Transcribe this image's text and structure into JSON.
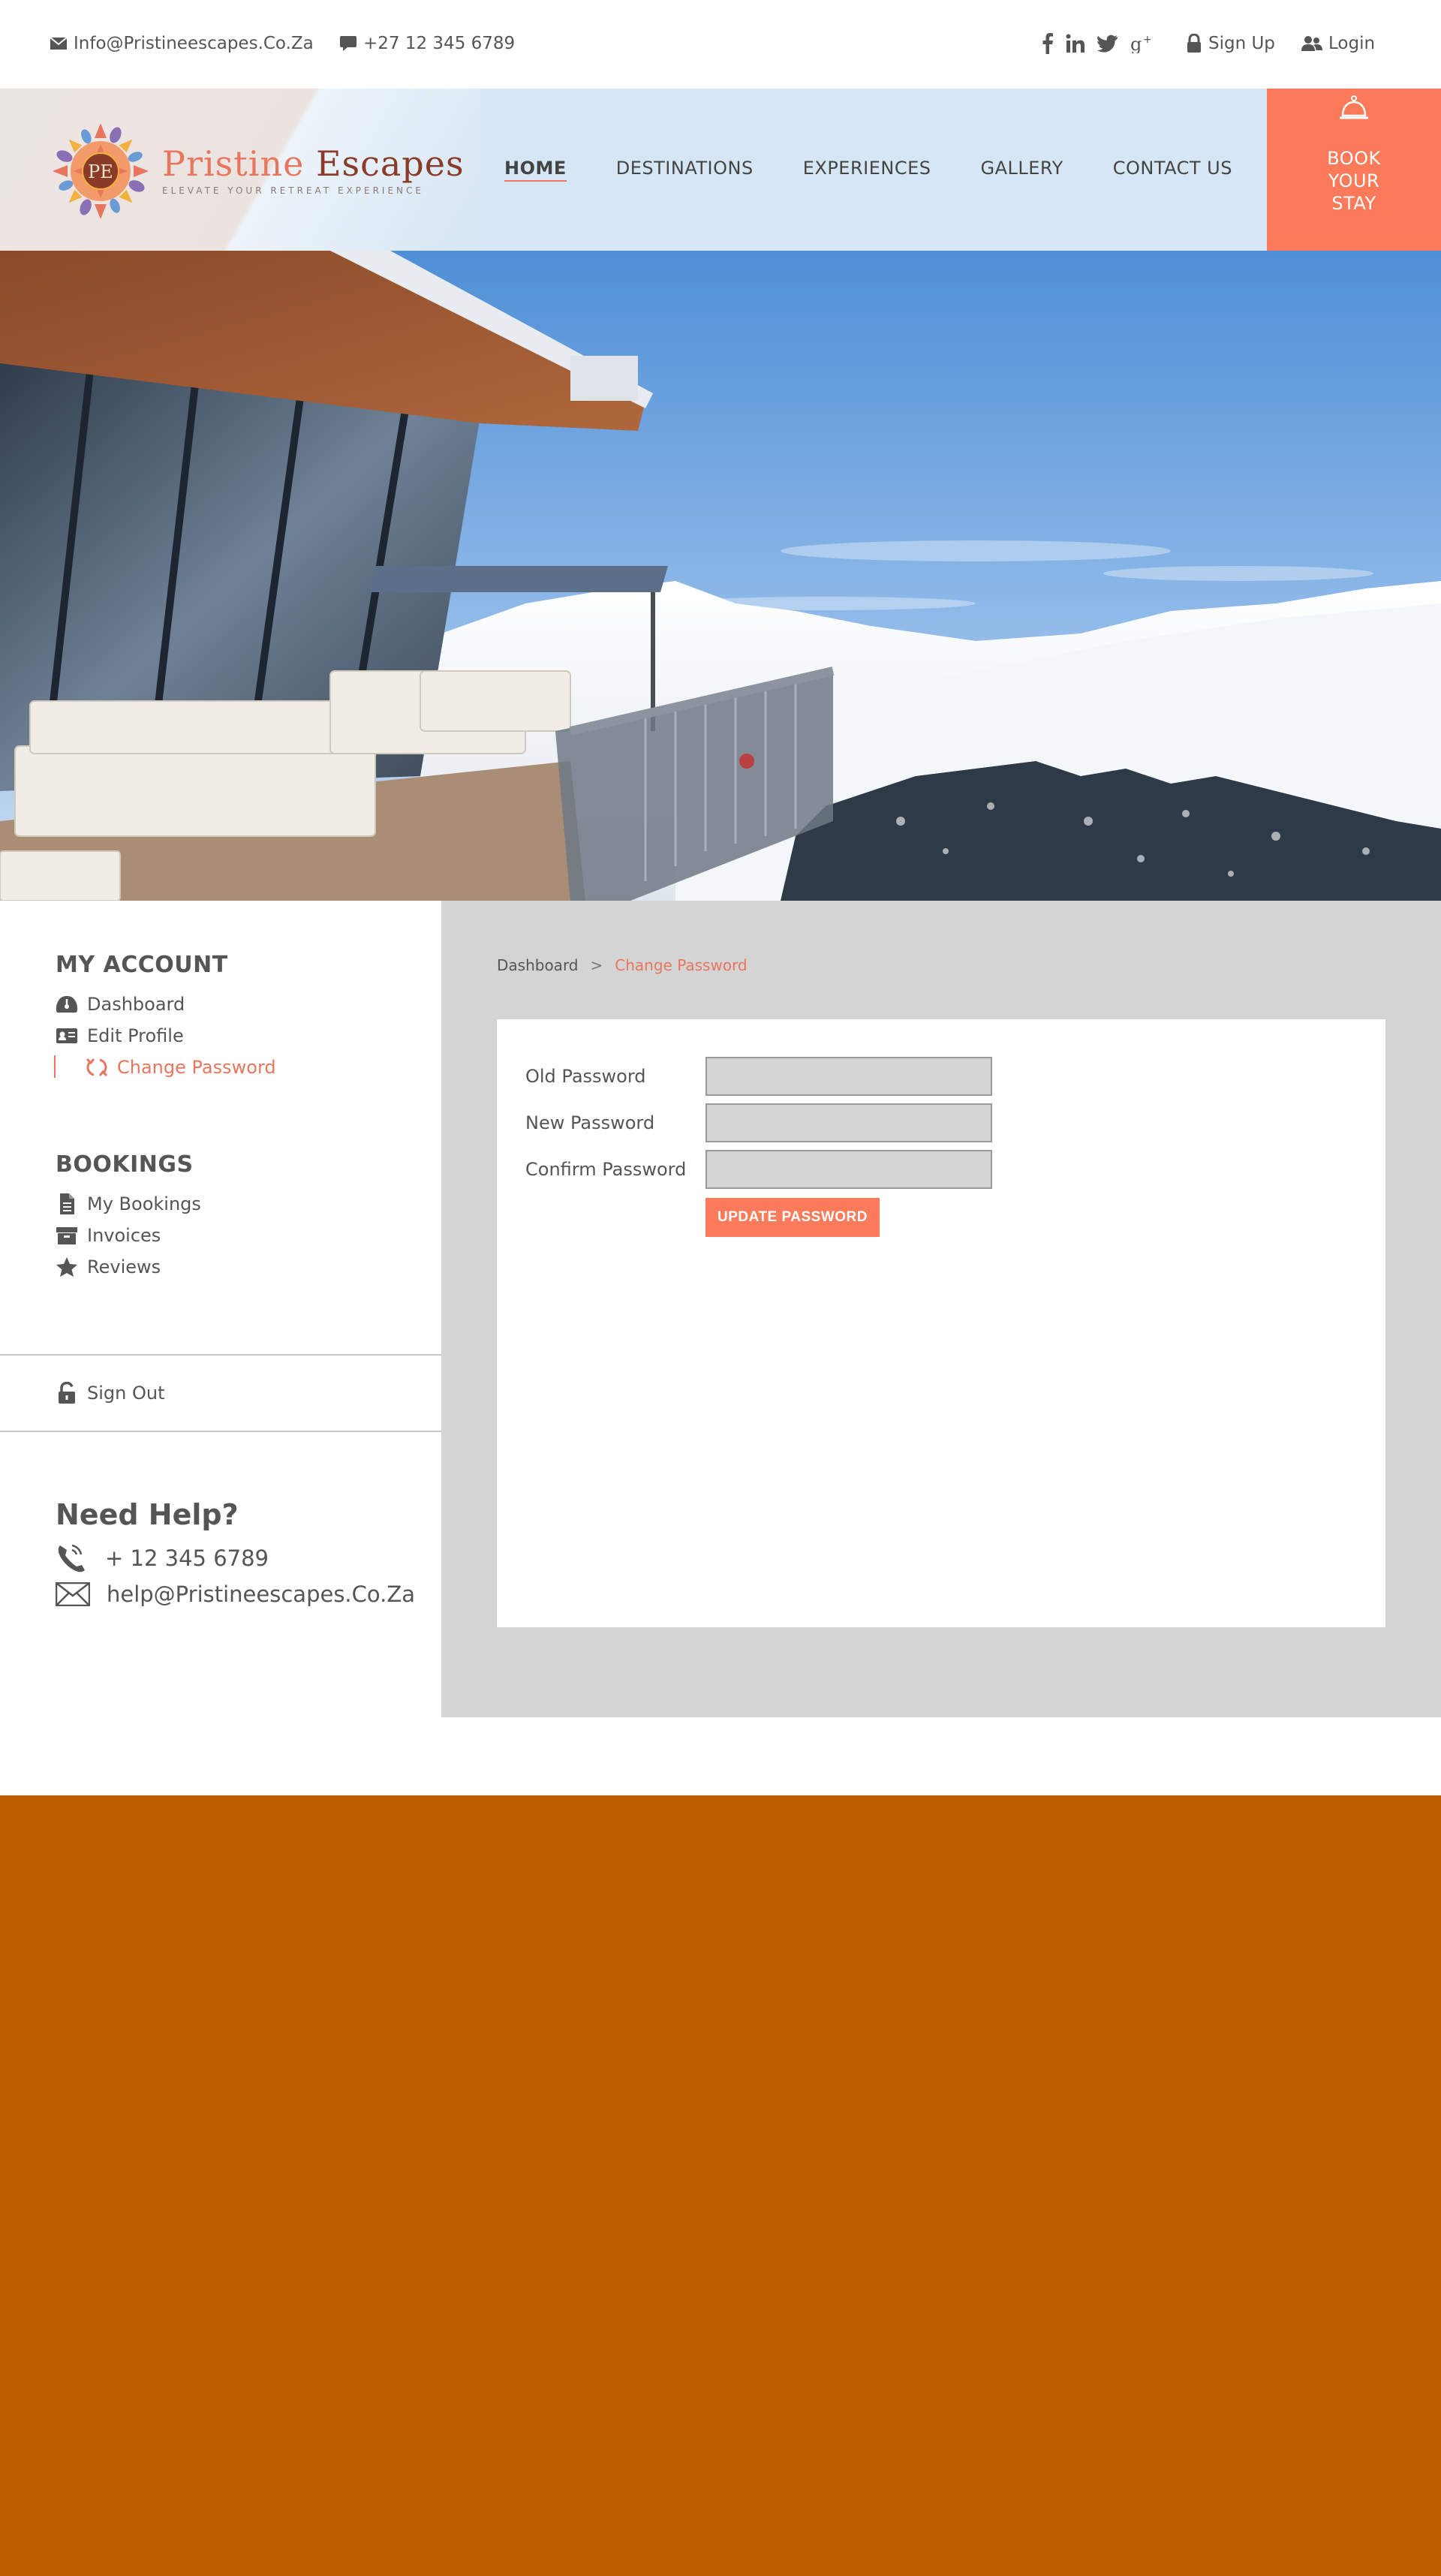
{
  "topbar": {
    "email": "Info@Pristineescapes.Co.Za",
    "phone": "+27 12 345 6789",
    "social": [
      "facebook-icon",
      "linkedin-icon",
      "twitter-icon",
      "google-plus-icon"
    ],
    "signup_label": "Sign Up",
    "login_label": "Login"
  },
  "brand": {
    "monogram": "PE",
    "name_part1": "Pristine ",
    "name_part2": "Escapes",
    "tagline": "ELEVATE YOUR RETREAT EXPERIENCE"
  },
  "nav": {
    "items": [
      "HOME",
      "DESTINATIONS",
      "EXPERIENCES",
      "GALLERY",
      "CONTACT US"
    ],
    "active": "HOME",
    "book_line1": "BOOK",
    "book_line2": "YOUR",
    "book_line3": "STAY"
  },
  "sidebar": {
    "account_heading": "MY ACCOUNT",
    "account_items": [
      "Dashboard",
      "Edit Profile",
      "Change Password"
    ],
    "bookings_heading": "BOOKINGS",
    "bookings_items": [
      "My Bookings",
      "Invoices",
      "Reviews"
    ],
    "signout_label": "Sign Out",
    "help_title": "Need Help?",
    "help_phone": "+ 12 345 6789",
    "help_email": "help@Pristineescapes.Co.Za"
  },
  "breadcrumb": {
    "root": "Dashboard",
    "separator": ">",
    "current": "Change Password"
  },
  "form": {
    "old_label": "Old Password",
    "new_label": "New Password",
    "confirm_label": "Confirm Password",
    "old_value": "",
    "new_value": "",
    "confirm_value": "",
    "submit_label": "UPDATE PASSWORD"
  },
  "colors": {
    "accent": "#fa7a59",
    "footer": "#bf5e00",
    "panel": "#d4d4d4",
    "header": "#d6e6f4"
  }
}
